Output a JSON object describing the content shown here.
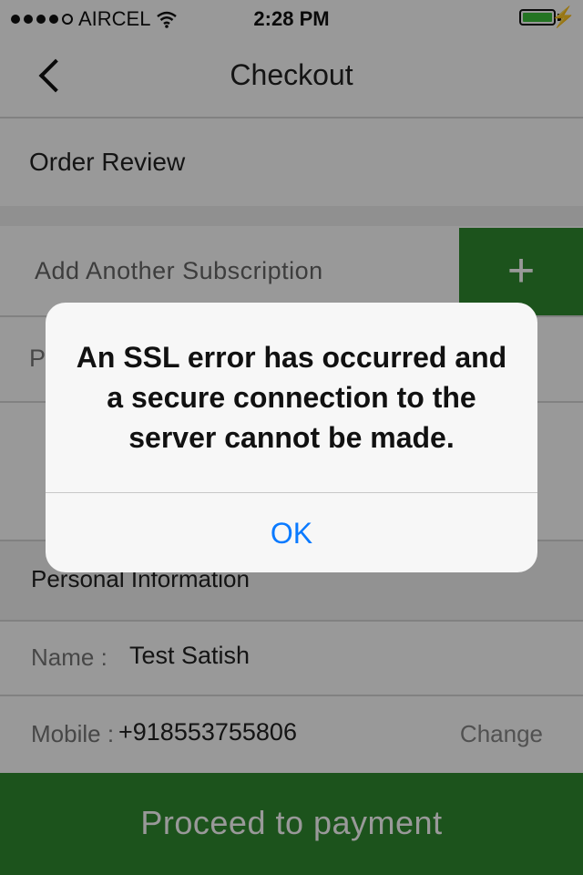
{
  "status_bar": {
    "carrier": "AIRCEL",
    "time": "2:28 PM",
    "battery_color": "#3cc13b"
  },
  "nav": {
    "title": "Checkout",
    "back_icon": "chevron-left-icon"
  },
  "sections": {
    "order_review": "Order Review",
    "add_subscription": "Add Another Subscription",
    "add_icon_symbol": "+",
    "partial_row_letter": "P",
    "personal_information": "Personal Information"
  },
  "personal": {
    "name_label": "Name :",
    "name_value": "Test Satish",
    "mobile_label": "Mobile :",
    "mobile_value": "+918553755806",
    "change_label": "Change"
  },
  "footer": {
    "proceed_label": "Proceed to payment",
    "accent_color": "#2f8a2f"
  },
  "alert": {
    "message": "An SSL error has occurred and a secure connection to the server cannot be made.",
    "ok_label": "OK",
    "ok_color": "#0a7aff"
  }
}
